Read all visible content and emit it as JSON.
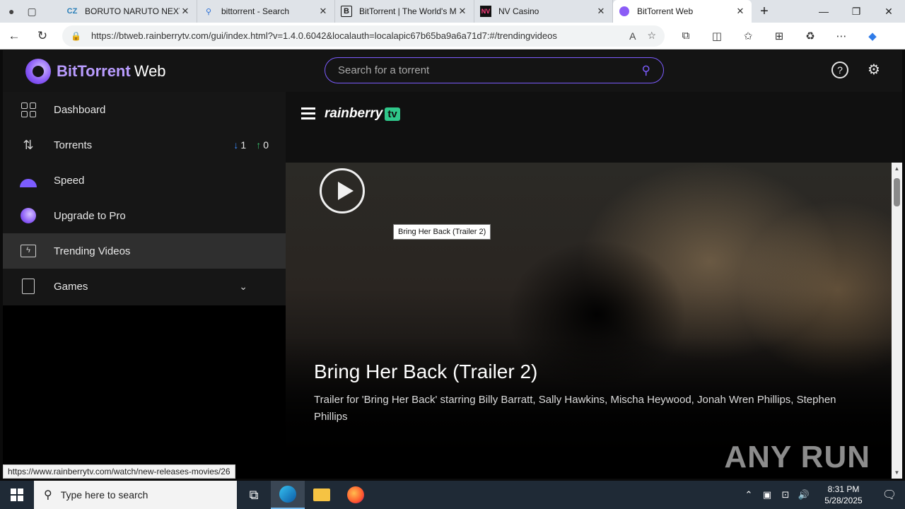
{
  "browser": {
    "tabs": [
      {
        "label": "BORUTO NARUTO NEXT G",
        "icon": "crunchy-icon"
      },
      {
        "label": "bittorrent - Search",
        "icon": "search-icon"
      },
      {
        "label": "BitTorrent | The World's M",
        "icon": "b-icon"
      },
      {
        "label": "NV Casino",
        "icon": "nv-icon"
      },
      {
        "label": "BitTorrent Web",
        "icon": "bittorrent-icon"
      }
    ],
    "active_tab": 4,
    "url": "https://btweb.rainberrytv.com/gui/index.html?v=1.4.0.6042&localauth=localapic67b65ba9a6a71d7:#/trendingvideos"
  },
  "app": {
    "logo_bold": "BitTorrent",
    "logo_light": "Web",
    "search_placeholder": "Search for a torrent"
  },
  "sidebar": {
    "items": [
      {
        "label": "Dashboard"
      },
      {
        "label": "Torrents",
        "down_count": "1",
        "up_count": "0"
      },
      {
        "label": "Speed"
      },
      {
        "label": "Upgrade to Pro"
      },
      {
        "label": "Trending Videos",
        "active": true
      },
      {
        "label": "Games",
        "expandable": true
      }
    ]
  },
  "rainberry": {
    "word": "rainberry",
    "tv": "tv"
  },
  "hero": {
    "tooltip": "Bring Her Back (Trailer 2)",
    "title": "Bring Her Back (Trailer 2)",
    "description": "Trailer for 'Bring Her Back' starring Billy Barratt, Sally Hawkins, Mischa Heywood, Jonah Wren Phillips, Stephen Phillips",
    "watermark": "ANY RUN"
  },
  "status_url": "https://www.rainberrytv.com/watch/new-releases-movies/26",
  "taskbar": {
    "search_placeholder": "Type here to search",
    "time": "8:31 PM",
    "date": "5/28/2025"
  },
  "colors": {
    "accent": "#7c5cff",
    "download": "#3a8bff",
    "upload": "#36c06b",
    "rainberry_green": "#2fc78a"
  }
}
